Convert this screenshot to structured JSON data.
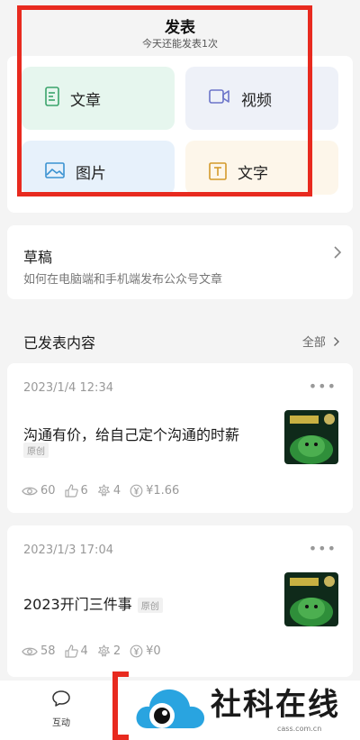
{
  "publish": {
    "title": "发表",
    "subtitle": "今天还能发表1次",
    "options": {
      "article": "文章",
      "video": "视频",
      "image": "图片",
      "text": "文字"
    }
  },
  "drafts": {
    "title": "草稿",
    "description": "如何在电脑端和手机端发布公众号文章"
  },
  "published": {
    "heading": "已发表内容",
    "all_label": "全部"
  },
  "posts": [
    {
      "date": "2023/1/4 12:34",
      "title": "沟通有价，给自己定个沟通的时薪",
      "badge": "原创",
      "views": "60",
      "likes": "6",
      "shares": "4",
      "earnings": "¥1.66"
    },
    {
      "date": "2023/1/3 17:04",
      "title": "2023开门三件事",
      "badge": "原创",
      "views": "58",
      "likes": "4",
      "shares": "2",
      "earnings": "¥0"
    }
  ],
  "bottom_nav": {
    "interact_label": "互动"
  },
  "watermark": {
    "text": "社科在线",
    "url": "cass.com.cn"
  },
  "colors": {
    "highlight_red": "#e82a1f",
    "article_tile": "#e6f6ee",
    "video_tile": "#eef1f8",
    "image_tile": "#e7f1fb",
    "text_tile": "#fdf6ea"
  }
}
